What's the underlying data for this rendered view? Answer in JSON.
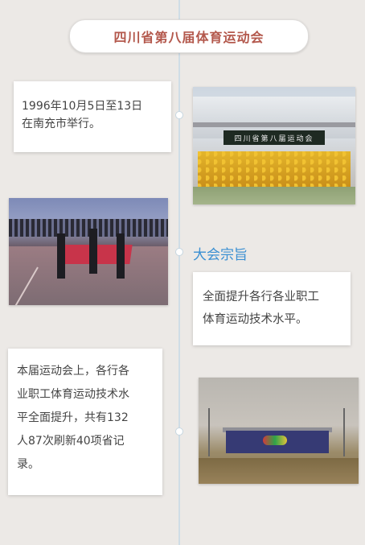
{
  "title": "四川省第八届体育运动会",
  "item1": {
    "text_lines": [
      "1996年10月5日至13日",
      "在南充市举行。"
    ]
  },
  "photo1": {
    "banner_text": "四川省第八届运动会"
  },
  "section": {
    "heading": "大会宗旨",
    "text_lines": [
      "全面提升各行各业职工",
      "体育运动技术水平。"
    ]
  },
  "item3": {
    "text_lines": [
      "本届运动会上，各行各",
      "业职工体育运动技术水",
      "平全面提升，共有132",
      "人87次刷新40项省记",
      "录。"
    ]
  },
  "colors": {
    "title_text": "#b3584c",
    "heading_text": "#3a8fd2",
    "timeline": "#cfdde6",
    "background": "#ece9e6"
  }
}
